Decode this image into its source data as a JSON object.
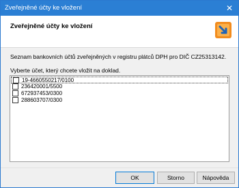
{
  "window": {
    "title": "Zveřejněné účty ke vložení",
    "close_glyph": "✕"
  },
  "header": {
    "title": "Zveřejněné účty ke vložení",
    "icon": "insert-accounts-icon"
  },
  "description": "Seznam bankovních účtů zveřejněných v registru plátců DPH pro DIČ CZ25313142.",
  "prompt": "Vyberte účet, který chcete vložit na doklad.",
  "accounts": [
    {
      "label": "19-4660550217/0100",
      "checked": false
    },
    {
      "label": "236420001/5500",
      "checked": false
    },
    {
      "label": "672937453/0300",
      "checked": false
    },
    {
      "label": "288603707/0300",
      "checked": false
    }
  ],
  "buttons": {
    "ok": "OK",
    "cancel": "Storno",
    "help": "Nápověda"
  },
  "colors": {
    "titlebar": "#2b7fd4",
    "icon_orange": "#f28c1e",
    "icon_blue": "#1e63b8"
  }
}
